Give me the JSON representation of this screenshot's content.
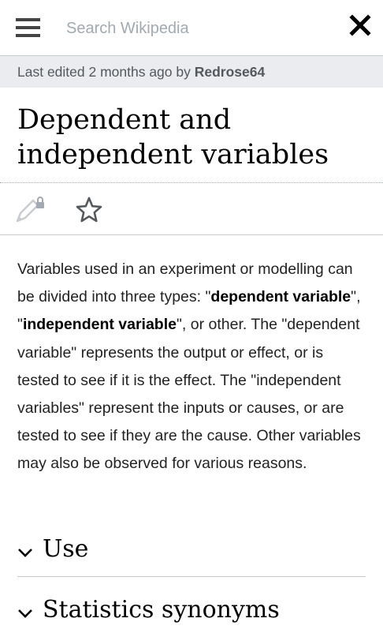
{
  "header": {
    "search_placeholder": "Search Wikipedia",
    "menu_icon": "hamburger-menu-icon",
    "close_icon": "close-icon"
  },
  "last_edited": {
    "prefix": "Last edited 2 months ago by ",
    "user": "Redrose64"
  },
  "article": {
    "title": "Dependent and independent variables",
    "actions": {
      "edit_icon": "pencil-locked-icon",
      "watch_icon": "star-icon"
    },
    "intro": {
      "p1": "Variables used in an experiment or modelling can be divided into three types: \"",
      "b1": "dependent variable",
      "p2": "\", \"",
      "b2": "independent variable",
      "p3": "\", or other. The \"dependent variable\" represents the output or effect, or is tested to see if it is the effect. The \"independent variables\" represent the inputs or causes, or are tested to see if they are the cause. Other variables may also be observed for various reasons."
    },
    "sections": [
      {
        "label": "Use"
      },
      {
        "label": "Statistics synonyms"
      }
    ]
  },
  "colors": {
    "banner_bg": "#eaecf0",
    "divider": "#c8ccd1",
    "placeholder": "#a2a9b1"
  }
}
